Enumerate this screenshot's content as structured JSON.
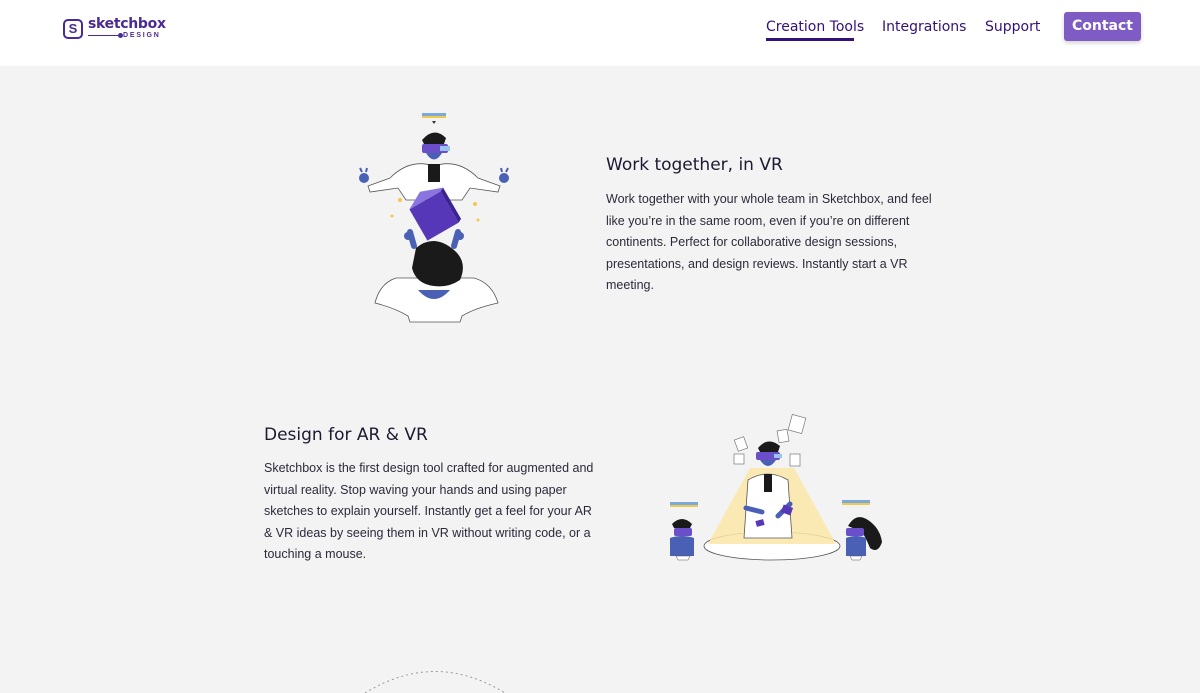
{
  "header": {
    "logo": {
      "mark": "S",
      "word": "sketchbox",
      "sub": "DESIGN"
    },
    "nav": [
      {
        "label": "Creation Tools",
        "active": true
      },
      {
        "label": "Integrations",
        "active": false
      },
      {
        "label": "Support",
        "active": false
      }
    ],
    "contact_label": "Contact"
  },
  "sections": [
    {
      "title": "Work together, in VR",
      "text": "Work together with your whole team in Sketchbox, and feel like you’re in the same room, even if you’re on different continents. Perfect for collaborative design sessions, presentations, and design reviews. Instantly start a VR meeting.",
      "illustration_icon": "vr-collaboration-illustration"
    },
    {
      "title": "Design for AR & VR",
      "text": "Sketchbox is the first design tool crafted for augmented and virtual reality. Stop waving your hands and using paper sketches to explain yourself. Instantly get a feel for your AR & VR ideas by seeing them in VR without writing code, or a touching a mouse.",
      "illustration_icon": "ar-vr-design-illustration"
    }
  ],
  "colors": {
    "brand": "#4a2a94",
    "nav": "#34107a",
    "button": "#7f5cc4",
    "background": "#f3f3f3"
  }
}
